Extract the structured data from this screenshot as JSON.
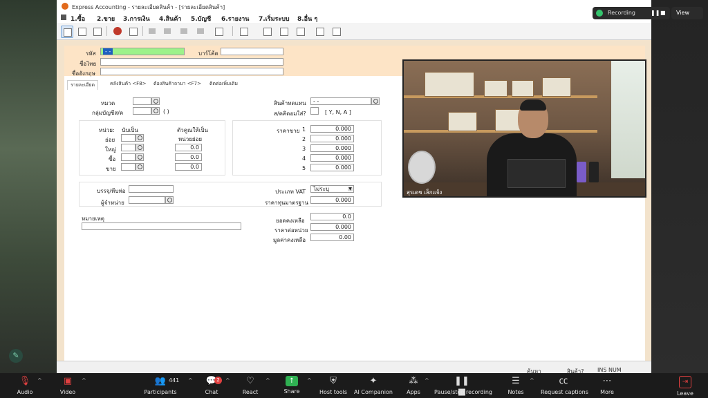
{
  "app": {
    "title": "Express Accounting - รายละเอียดสินค้า - [รายละเอียดสินค้า]",
    "menu": [
      "1.ซื้อ",
      "2.ขาย",
      "3.การเงิน",
      "4.สินค้า",
      "5.บัญชี",
      "6.รายงาน",
      "7.เริ่มระบบ",
      "8.อื่น ๆ"
    ],
    "toolbar_icons": [
      "new-doc-icon",
      "edit-icon",
      "delete-icon",
      "cancel-icon",
      "save-icon",
      "first-icon",
      "prev-icon",
      "next-icon",
      "last-icon",
      "search-icon",
      "print-icon",
      "grid-icon",
      "list-icon",
      "report-icon",
      "layout-icon",
      "window-icon"
    ],
    "status_bar": {
      "left": "ค้นหา",
      "mid": "สินค้า?",
      "right": "INS  NUM"
    }
  },
  "form": {
    "code_label": "รหัส",
    "code_value": "-   -",
    "barcode_label": "บาร์โค้ด",
    "thai_name_label": "ชื่อไทย",
    "eng_name_label": "ชื่ออังกฤษ",
    "tabs": [
      "รายละเอียด",
      "คลังสินค้า <F8>",
      "ต้องสินค้าถามา <F7>",
      "ติดต่อเพิ่มเติม"
    ],
    "category_label": "หมวด",
    "account_group_label": "กลุ่มบัญชีส/ค",
    "account_group_paren": "(    )",
    "substitute_label": "สินค้าทดแทน",
    "substitute_value": "-   -",
    "prompt_label": "ส/คคิดอมใส่?",
    "prompt_options": "[ Y, N, A ]",
    "unit_header": "หน่วย:",
    "count_as_header": "นับเป็น",
    "factor_header_1": "ตัวคูณให้เป็น",
    "factor_header_2": "หน่วยย่อย",
    "units": [
      {
        "label": "ย่อย",
        "factor": ""
      },
      {
        "label": "ใหญ่",
        "factor": "0.0"
      },
      {
        "label": "ซื้อ",
        "factor": "0.0"
      },
      {
        "label": "ขาย",
        "factor": "0.0"
      }
    ],
    "price_label": "ราคาขาย",
    "prices": [
      {
        "n": "1",
        "v": "0.000"
      },
      {
        "n": "2",
        "v": "0.000"
      },
      {
        "n": "3",
        "v": "0.000"
      },
      {
        "n": "4",
        "v": "0.000"
      },
      {
        "n": "5",
        "v": "0.000"
      }
    ],
    "pack_label": "บรรจุ/หีบห่อ",
    "supplier_label": "ผู้จำหน่าย",
    "vat_label": "ประเภท VAT",
    "vat_value": "ไม่ระบุ",
    "std_cost_label": "ราคาทุนมาตรฐาน",
    "std_cost_value": "0.000",
    "remark_label": "หมายเหตุ",
    "balance_label": "ยอดคงเหลือ",
    "balance_value": "0.0",
    "unit_cost_label": "ราคาต่อหน่วย",
    "unit_cost_value": "0.000",
    "balance_amount_label": "มูลค่าคงเหลือ",
    "balance_amount_value": "0.00"
  },
  "video": {
    "name": "สุรเดช เล็กแจ้ง"
  },
  "zoom": {
    "recording_label": "Recording",
    "view_label": "View",
    "chat_badge": "2",
    "participants_count": "441",
    "controls": [
      {
        "label": "Audio",
        "icon": "mic-muted-icon"
      },
      {
        "label": "Video",
        "icon": "video-off-icon"
      },
      {
        "label": "Participants",
        "icon": "participants-icon"
      },
      {
        "label": "Chat",
        "icon": "chat-icon"
      },
      {
        "label": "React",
        "icon": "heart-icon"
      },
      {
        "label": "Share",
        "icon": "share-icon"
      },
      {
        "label": "Host tools",
        "icon": "shield-icon"
      },
      {
        "label": "AI Companion",
        "icon": "sparkle-icon"
      },
      {
        "label": "Apps",
        "icon": "apps-icon"
      },
      {
        "label": "Pause/stop recording",
        "icon": "pause-stop-icon"
      },
      {
        "label": "Notes",
        "icon": "notes-icon"
      },
      {
        "label": "Request captions",
        "icon": "captions-icon"
      },
      {
        "label": "More",
        "icon": "more-icon"
      },
      {
        "label": "Leave",
        "icon": "leave-icon"
      }
    ]
  }
}
